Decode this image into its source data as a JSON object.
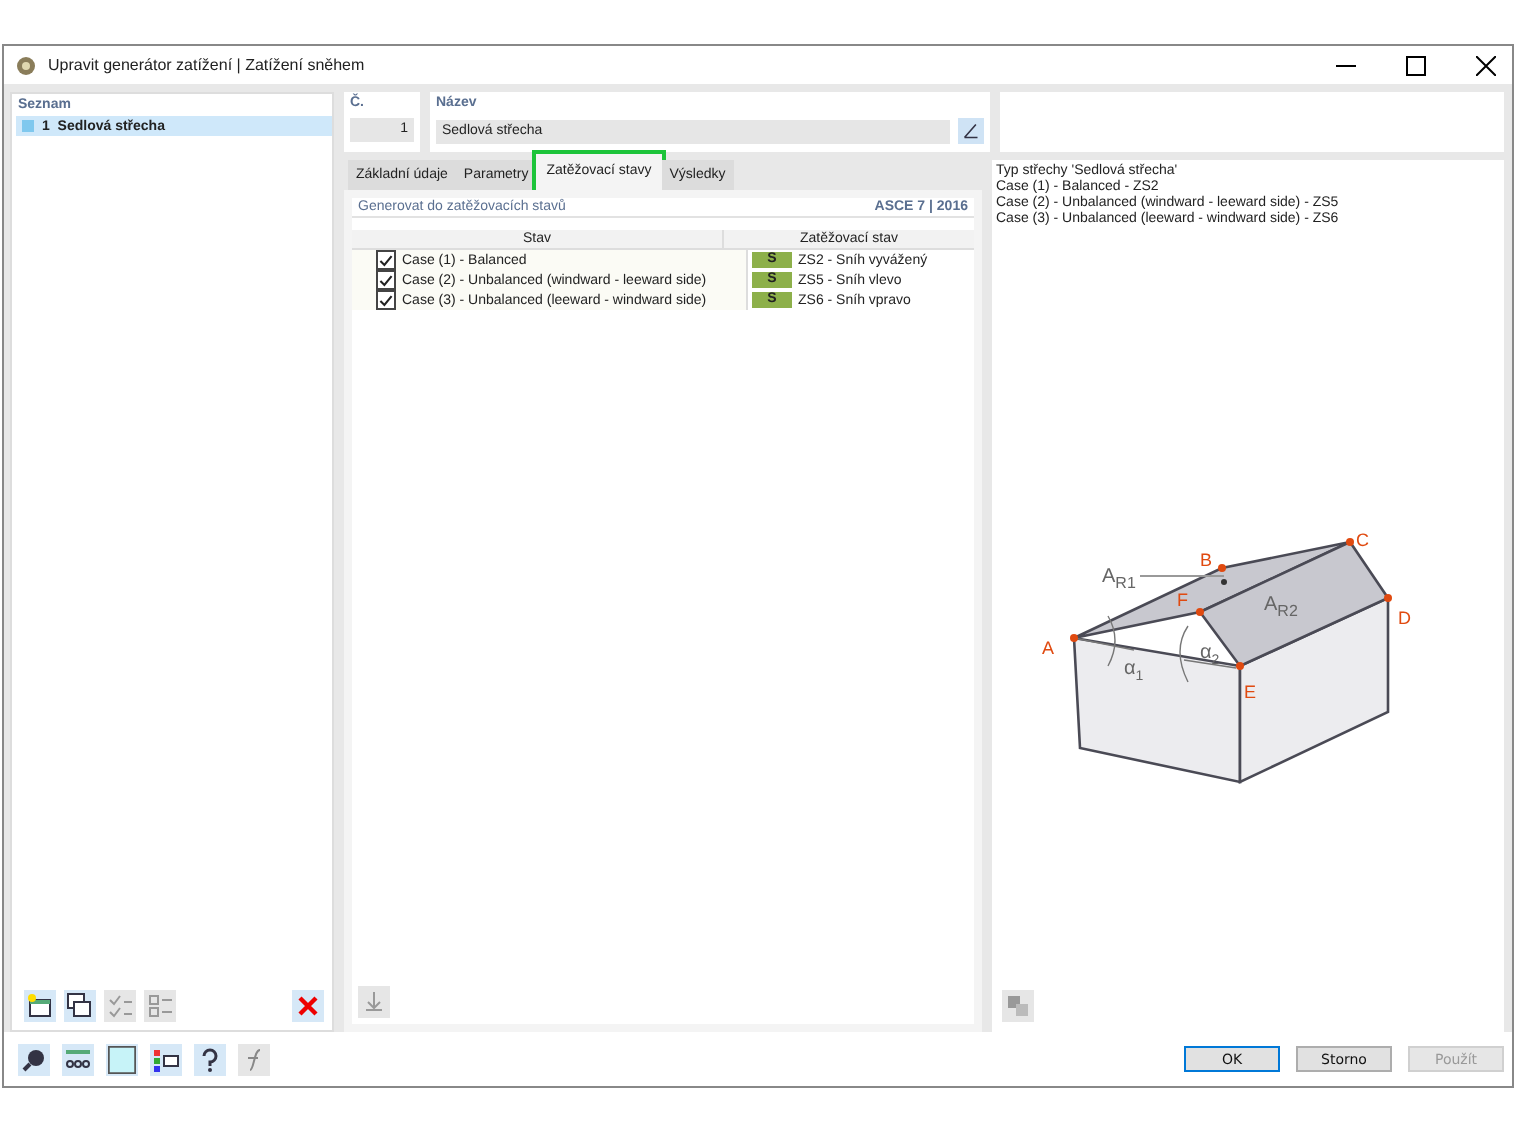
{
  "window": {
    "title": "Upravit generátor zatížení | Zatížení sněhem"
  },
  "list": {
    "header": "Seznam",
    "items": [
      {
        "number": "1",
        "name": "Sedlová střecha",
        "selected": true
      }
    ]
  },
  "number": {
    "label": "Č.",
    "value": "1"
  },
  "name": {
    "label": "Název",
    "value": "Sedlová střecha"
  },
  "tabs": [
    {
      "label": "Základní údaje",
      "selected": false,
      "highlighted": false
    },
    {
      "label": "Parametry",
      "selected": false,
      "highlighted": false
    },
    {
      "label": "Zatěžovací stavy",
      "selected": true,
      "highlighted": true
    },
    {
      "label": "Výsledky",
      "selected": false,
      "highlighted": false
    }
  ],
  "cases_panel": {
    "title": "Generovat do zatěžovacích stavů",
    "standard": "ASCE 7 | 2016",
    "columns": [
      "Stav",
      "Zatěžovací stav"
    ],
    "rows": [
      {
        "checked": true,
        "case": "Case (1) - Balanced",
        "tag": "S",
        "load_case": "ZS2 - Sníh vyvážený"
      },
      {
        "checked": true,
        "case": "Case (2) - Unbalanced (windward - leeward side)",
        "tag": "S",
        "load_case": "ZS5 - Sníh vlevo"
      },
      {
        "checked": true,
        "case": "Case (3) - Unbalanced (leeward - windward side)",
        "tag": "S",
        "load_case": "ZS6 - Sníh vpravo"
      }
    ]
  },
  "info": {
    "lines": [
      "Typ střechy 'Sedlová střecha'",
      "Case (1) - Balanced - ZS2",
      "Case (2) - Unbalanced (windward - leeward side) - ZS5",
      "Case (3) - Unbalanced (leeward - windward side) - ZS6"
    ]
  },
  "diagram": {
    "points": [
      "A",
      "B",
      "C",
      "D",
      "E",
      "F"
    ],
    "areas": [
      "A$_{R1}$",
      "A$_{R2}$"
    ],
    "angles": [
      "α$_{1}$",
      "α$_{2}$"
    ]
  },
  "buttons": [
    {
      "label": "OK",
      "kind": "default",
      "disabled": false
    },
    {
      "label": "Storno",
      "kind": "normal",
      "disabled": false
    },
    {
      "label": "Použít",
      "kind": "normal",
      "disabled": true
    }
  ]
}
